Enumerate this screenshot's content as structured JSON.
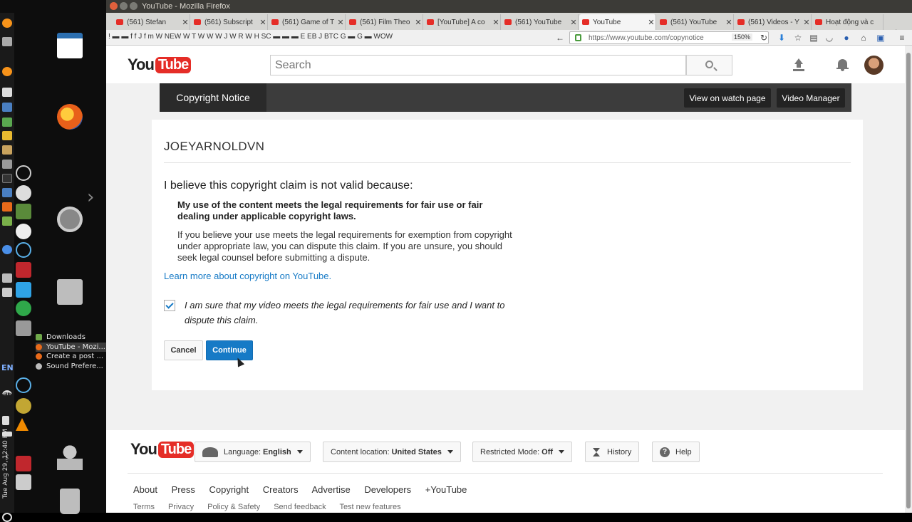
{
  "window": {
    "title": "YouTube - Mozilla Firefox"
  },
  "tabs": [
    {
      "label": "(561) Stefan",
      "active": false
    },
    {
      "label": "(561) Subscript",
      "active": false
    },
    {
      "label": "(561) Game of T",
      "active": false
    },
    {
      "label": "(561) Film Theo",
      "active": false
    },
    {
      "label": "[YouTube] A co",
      "active": false
    },
    {
      "label": "(561) YouTube",
      "active": false
    },
    {
      "label": "YouTube",
      "active": true
    },
    {
      "label": "(561) YouTube",
      "active": false
    },
    {
      "label": "(561) Videos - Y",
      "active": false
    },
    {
      "label": "Hoạt động và c",
      "active": false
    }
  ],
  "bookmarks_text": "! ▬ ▬ f f J f m W NEW W T W W W J W R W H SC ▬ ▬ ▬ E EB J BTC G ▬ G ▬ WOW",
  "url": "https://www.youtube.com/copynotice",
  "zoom": "150%",
  "taskbar": {
    "items": [
      {
        "label": "Downloads",
        "active": false,
        "color": "#6fa84a"
      },
      {
        "label": "YouTube - Mozi...",
        "active": true,
        "color": "#e86a1a"
      },
      {
        "label": "Create a post ...",
        "active": false,
        "color": "#e86a1a"
      },
      {
        "label": "Sound Prefere...",
        "active": false,
        "color": "#bbbbbb"
      }
    ],
    "lang": "EN",
    "lang_small": "en",
    "clock": "Tue Aug 29, 12:40 PM"
  },
  "header": {
    "logo_you": "You",
    "logo_tube": "Tube",
    "search_placeholder": "Search"
  },
  "notice_bar": {
    "tab_label": "Copyright Notice",
    "watch_page_btn": "View on watch page",
    "video_manager_btn": "Video Manager"
  },
  "card": {
    "channel_name": "JOEYARNOLDVN",
    "claim_heading": "I believe this copyright claim is not valid because:",
    "reason_bold": "My use of the content meets the legal requirements for fair use or fair dealing under applicable copyright laws.",
    "reason_text": "If you believe your use meets the legal requirements for exemption from copyright under appropriate law, you can dispute this claim. If you are unsure, you should seek legal counsel before submitting a dispute.",
    "learn_link": "Learn more about copyright on YouTube.",
    "agree_text": "I am sure that my video meets the legal requirements for fair use and I want to dispute this claim.",
    "agree_checked": true,
    "cancel_label": "Cancel",
    "continue_label": "Continue"
  },
  "footer": {
    "language_label": "Language:",
    "language_value": "English",
    "content_location_label": "Content location:",
    "content_location_value": "United States",
    "restricted_label": "Restricted Mode:",
    "restricted_value": "Off",
    "history_label": "History",
    "help_label": "Help",
    "links_primary": [
      "About",
      "Press",
      "Copyright",
      "Creators",
      "Advertise",
      "Developers",
      "+YouTube"
    ],
    "links_secondary": [
      "Terms",
      "Privacy",
      "Policy & Safety",
      "Send feedback",
      "Test new features"
    ]
  },
  "colors": {
    "brand_red": "#e52d27",
    "link_blue": "#167ac6",
    "notice_dark": "#3c3c3c"
  }
}
